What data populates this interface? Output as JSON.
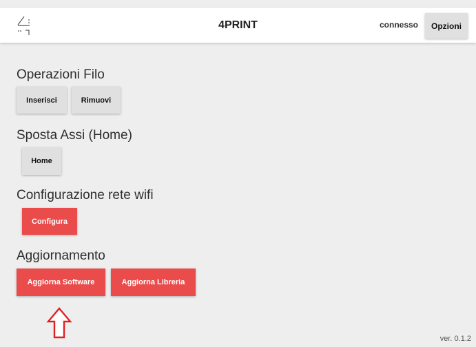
{
  "header": {
    "title": "4PRINT",
    "status": "connesso",
    "options_label": "Opzioni"
  },
  "sections": {
    "filo": {
      "title": "Operazioni Filo",
      "insert_label": "Inserisci",
      "remove_label": "Rimuovi"
    },
    "assi": {
      "title": "Sposta Assi (Home)",
      "home_label": "Home"
    },
    "wifi": {
      "title": "Configurazione rete wifi",
      "configure_label": "Configura"
    },
    "update": {
      "title": "Aggiornamento",
      "software_label": "Aggiorna Software",
      "library_label": "Aggiorna Libreria"
    }
  },
  "footer": {
    "version": "ver. 0.1.2"
  },
  "icons": {
    "logo": "printer-logo-icon",
    "annotation": "arrow-up-outline-icon"
  },
  "colors": {
    "background": "#eeeeee",
    "header_bg": "#ffffff",
    "primary_red": "#ea4b4b",
    "grey_button": "#e0e0e0",
    "annotation_arrow": "#e02020"
  }
}
